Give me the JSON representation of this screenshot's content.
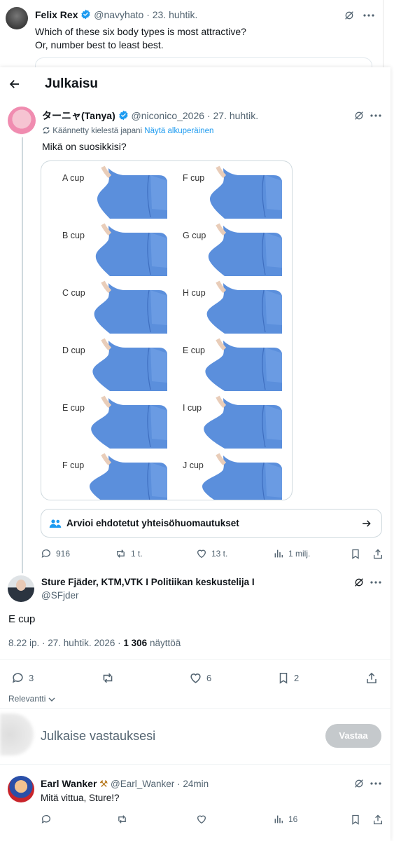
{
  "top_tweet": {
    "author": "Felix Rex",
    "handle": "@navyhato",
    "date": "23. huhtik.",
    "line1": "Which of these six body types is most attractive?",
    "line2": "Or, number best to least best."
  },
  "header": {
    "title": "Julkaisu"
  },
  "post": {
    "author": "ターニャ(Tanya)",
    "handle": "@niconico_2026",
    "date": "27. huhtik.",
    "translated_note": "Käännetty kielestä japani",
    "show_original": "Näytä alkuperäinen",
    "text": "Mikä on suosikkisi?",
    "cups_left": [
      "A cup",
      "B cup",
      "C cup",
      "D cup",
      "E cup",
      "F cup"
    ],
    "cups_right": [
      "F cup",
      "G cup",
      "H cup",
      "E cup",
      "I cup",
      "J cup"
    ],
    "community_notes": "Arvioi ehdotetut yhteisöhuomautukset",
    "stats": {
      "replies": "916",
      "reposts": "1 t.",
      "likes": "13 t.",
      "views": "1 milj."
    }
  },
  "reply": {
    "author": "Sture Fjäder, KTM,VTK I Politiikan keskustelija I",
    "handle": "@SFjder",
    "text": "E cup",
    "time": "8.22 ip. · 27. huhtik. 2026 ·",
    "views_count": "1 306",
    "views_label": "näyttöä",
    "stats": {
      "replies": "3",
      "likes": "6",
      "bookmarks": "2"
    }
  },
  "sort": {
    "label": "Relevantti"
  },
  "composer": {
    "placeholder": "Julkaise vastauksesi",
    "button": "Vastaa"
  },
  "bottom_reply": {
    "author": "Earl Wanker",
    "emoji": "⚒",
    "handle": "@Earl_Wanker",
    "date": "24min",
    "text": "Mitä vittua, Sture!?",
    "stats": {
      "views": "16"
    }
  },
  "colors": {
    "accent": "#1d9bf0",
    "text": "#0f1419",
    "muted": "#536471",
    "shirt": "#5b8fdc"
  }
}
